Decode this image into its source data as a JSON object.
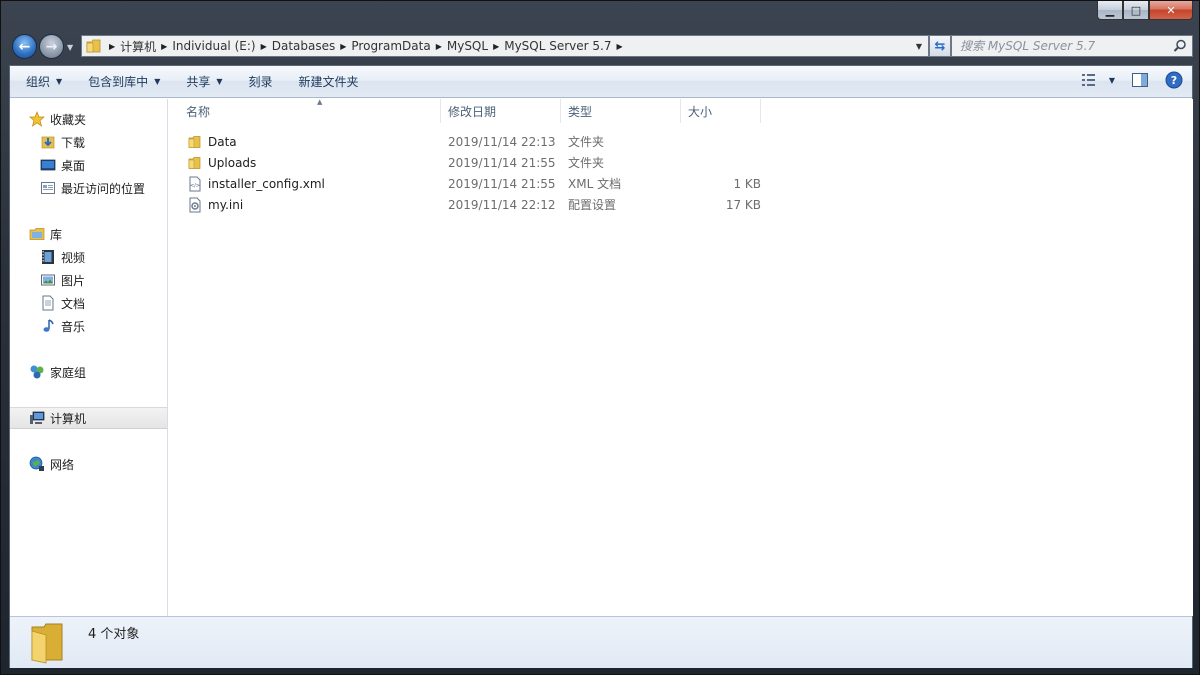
{
  "window": {
    "minimize_label": "▁",
    "maximize_label": "□",
    "close_label": "✕"
  },
  "address_bar": {
    "crumbs": [
      "计算机",
      "Individual (E:)",
      "Databases",
      "ProgramData",
      "MySQL",
      "MySQL Server 5.7"
    ]
  },
  "search": {
    "placeholder": "搜索 MySQL Server 5.7"
  },
  "toolbar": {
    "organize": "组织",
    "include_in_library": "包含到库中",
    "share": "共享",
    "burn": "刻录",
    "new_folder": "新建文件夹"
  },
  "navpane": {
    "favorites": "收藏夹",
    "downloads": "下载",
    "desktop": "桌面",
    "recent": "最近访问的位置",
    "libraries": "库",
    "videos": "视频",
    "pictures": "图片",
    "documents": "文档",
    "music": "音乐",
    "homegroup": "家庭组",
    "computer": "计算机",
    "network": "网络"
  },
  "columns": {
    "name": "名称",
    "date": "修改日期",
    "type": "类型",
    "size": "大小"
  },
  "files": [
    {
      "name": "Data",
      "date": "2019/11/14 22:13",
      "type": "文件夹",
      "size": "",
      "icon": "folder-icon"
    },
    {
      "name": "Uploads",
      "date": "2019/11/14 21:55",
      "type": "文件夹",
      "size": "",
      "icon": "folder-icon"
    },
    {
      "name": "installer_config.xml",
      "date": "2019/11/14 21:55",
      "type": "XML 文档",
      "size": "1 KB",
      "icon": "xml-file-icon"
    },
    {
      "name": "my.ini",
      "date": "2019/11/14 22:12",
      "type": "配置设置",
      "size": "17 KB",
      "icon": "ini-file-icon"
    }
  ],
  "details": {
    "count_text": "4 个对象"
  },
  "colors": {
    "toolbar_text": "#1e395b",
    "column_header_text": "#4c607a",
    "folder_yellow": "#e8c04e"
  }
}
